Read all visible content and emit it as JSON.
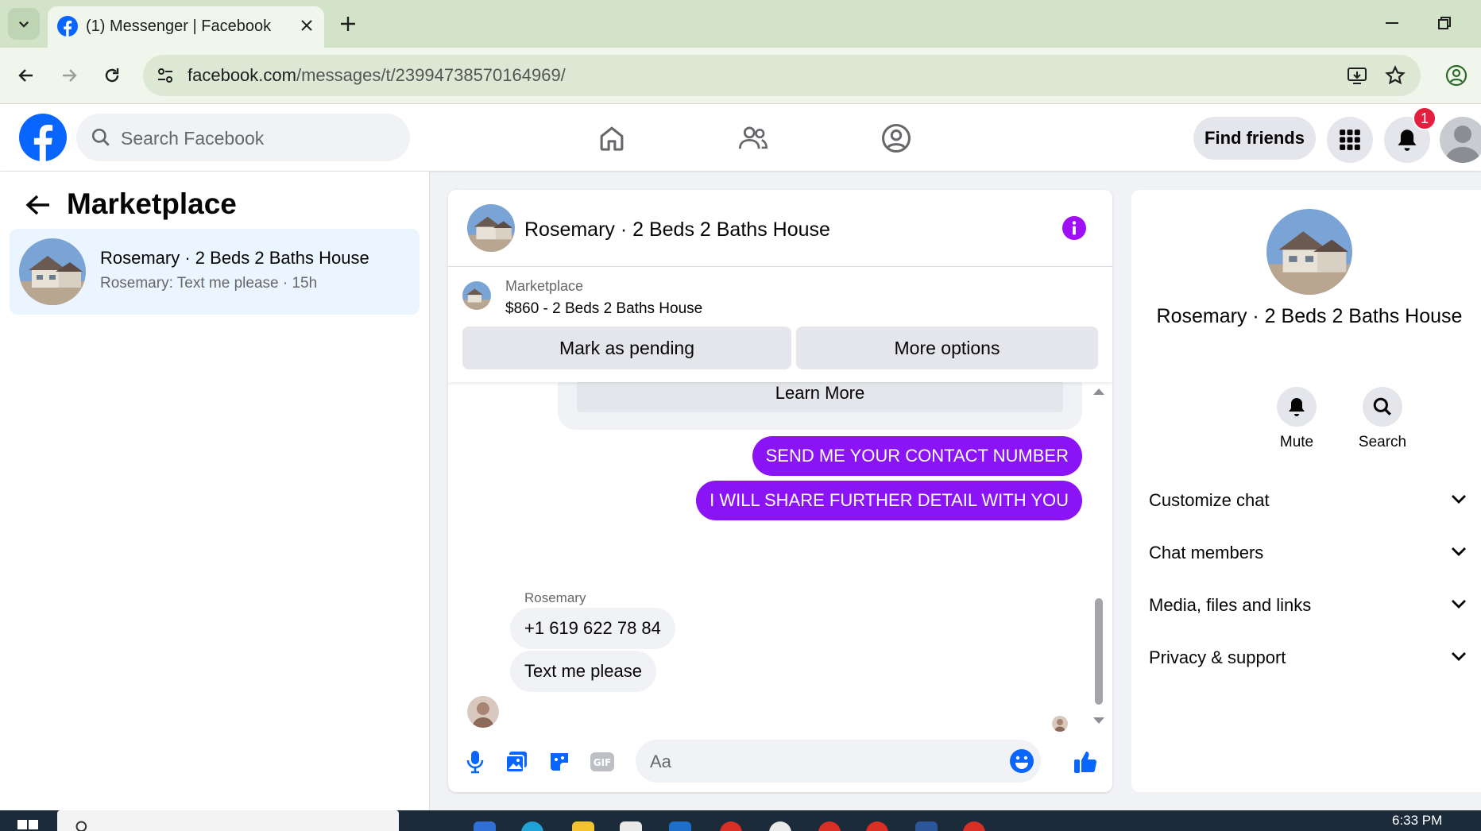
{
  "browser": {
    "tab_title": "(1) Messenger | Facebook",
    "url_domain": "facebook.com",
    "url_path": "/messages/t/23994738570164969/"
  },
  "fb_header": {
    "search_placeholder": "Search Facebook",
    "find_friends_label": "Find friends",
    "notification_count": "1"
  },
  "left_panel": {
    "title": "Marketplace",
    "conversations": [
      {
        "name": "Rosemary · 2 Beds 2 Baths House",
        "preview": "Rosemary: Text me please · 15h"
      }
    ]
  },
  "chat": {
    "title": "Rosemary · 2 Beds 2 Baths House",
    "marketplace_label": "Marketplace",
    "listing": "$860 - 2 Beds 2 Baths House",
    "mark_pending_label": "Mark as pending",
    "more_options_label": "More options",
    "learn_more_label": "Learn More",
    "outgoing": [
      "SEND ME YOUR CONTACT NUMBER",
      "I WILL SHARE FURTHER DETAIL WITH YOU"
    ],
    "incoming_sender": "Rosemary",
    "incoming": [
      "+1 619 622 78 84",
      "Text me please"
    ],
    "composer_placeholder": "Aa"
  },
  "right_panel": {
    "name": "Rosemary · 2 Beds 2 Baths House",
    "actions": [
      "Mute",
      "Search"
    ],
    "sections": [
      "Customize chat",
      "Chat members",
      "Media, files and links",
      "Privacy & support"
    ]
  },
  "taskbar": {
    "clock": "6:33 PM"
  },
  "colors": {
    "fb_blue": "#0866ff",
    "messenger_purple": "#8a14f5",
    "badge_red": "#e41e3f",
    "chrome_green": "#d3e3c8"
  }
}
